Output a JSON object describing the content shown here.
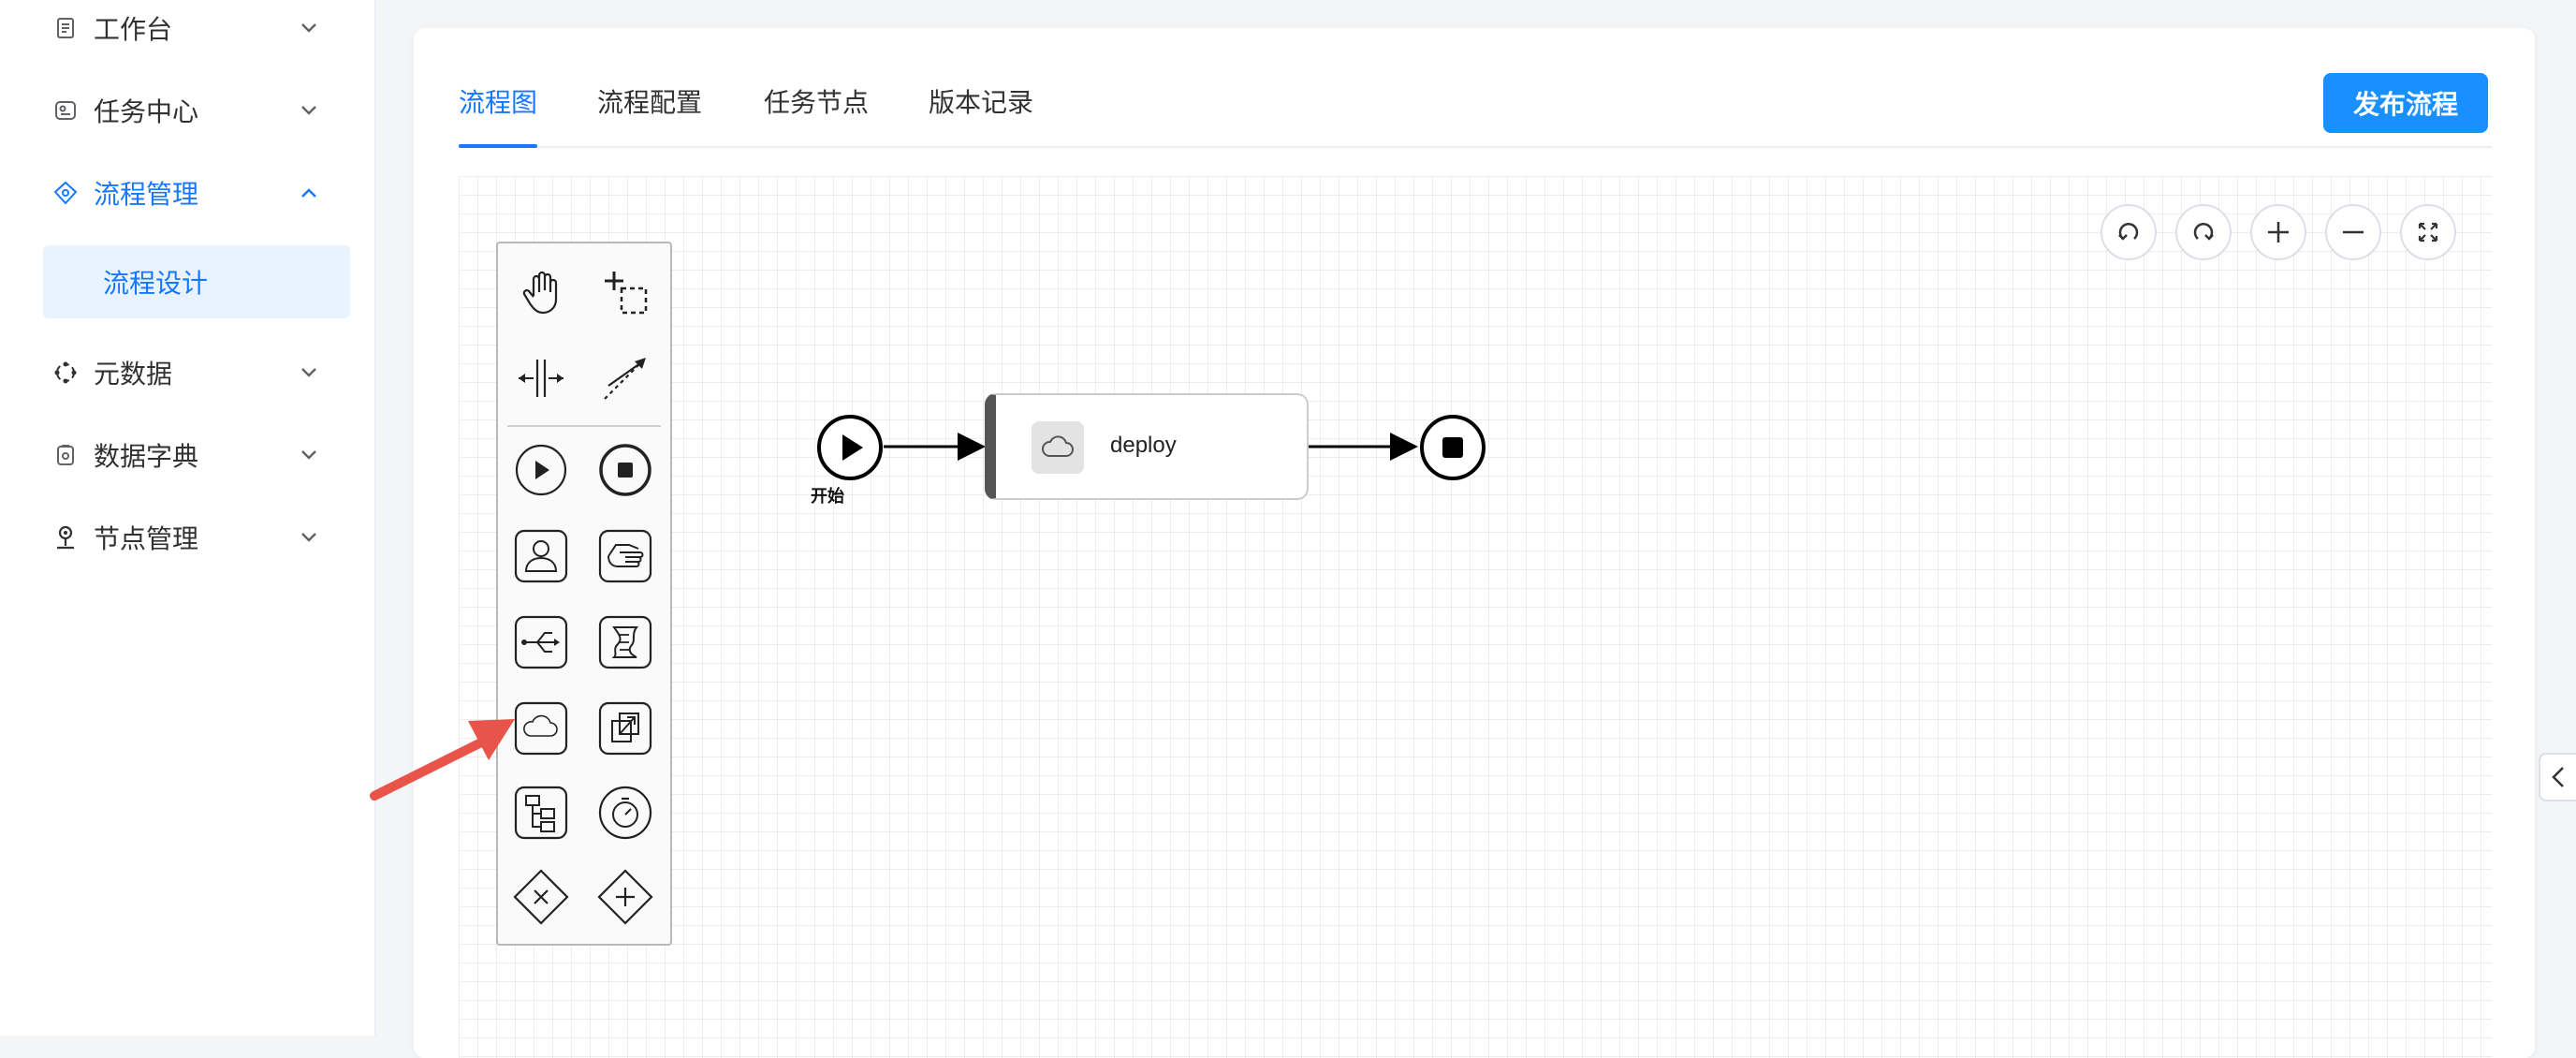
{
  "sidebar": {
    "items": [
      {
        "label": "工作台",
        "icon": "document-icon",
        "expanded": false
      },
      {
        "label": "任务中心",
        "icon": "task-center-icon",
        "expanded": false
      },
      {
        "label": "流程管理",
        "icon": "flow-icon",
        "expanded": true
      },
      {
        "label": "元数据",
        "icon": "metadata-icon",
        "expanded": false
      },
      {
        "label": "数据字典",
        "icon": "dictionary-icon",
        "expanded": false
      },
      {
        "label": "节点管理",
        "icon": "location-pin-icon",
        "expanded": false
      }
    ],
    "submenu": [
      {
        "label": "流程设计",
        "active": true
      }
    ]
  },
  "tabs": [
    {
      "label": "流程图",
      "active": true
    },
    {
      "label": "流程配置",
      "active": false
    },
    {
      "label": "任务节点",
      "active": false
    },
    {
      "label": "版本记录",
      "active": false
    }
  ],
  "publish_button": {
    "label": "发布流程"
  },
  "palette": {
    "tools": [
      "hand-tool-icon",
      "lasso-tool-icon",
      "space-tool-icon",
      "connect-tool-icon"
    ],
    "elements": [
      "start-event-icon",
      "end-event-icon",
      "user-task-icon",
      "manual-task-icon",
      "service-task-icon",
      "script-task-icon",
      "cloud-task-icon",
      "call-activity-icon",
      "subprocess-icon",
      "timer-event-icon",
      "exclusive-gateway-icon",
      "parallel-gateway-icon"
    ]
  },
  "zoom_controls": [
    "undo-icon",
    "redo-icon",
    "zoom-in-icon",
    "zoom-out-icon",
    "fit-screen-icon"
  ],
  "diagram": {
    "start_label": "开始",
    "task_label": "deploy",
    "task_icon": "cloud-icon"
  },
  "colors": {
    "accent": "#1677ff",
    "button": "#1890ff",
    "annotation_arrow": "#e8534a"
  }
}
